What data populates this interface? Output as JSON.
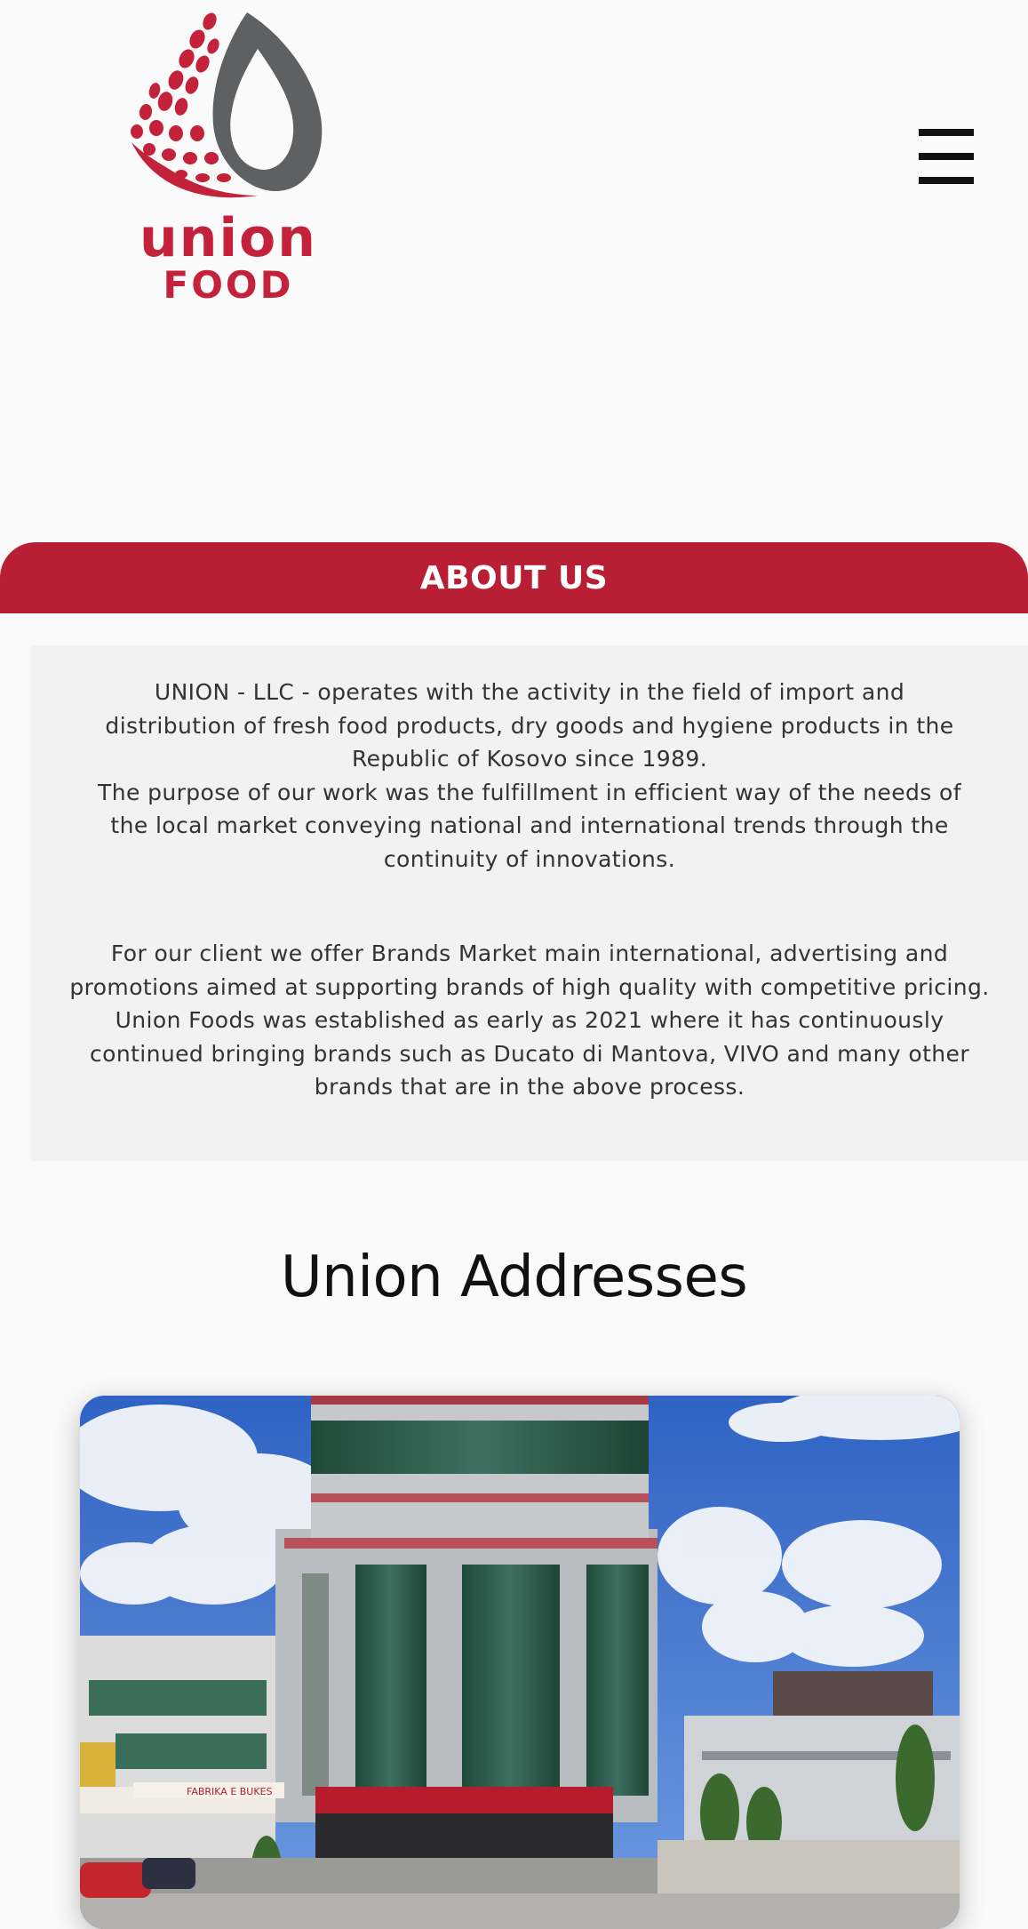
{
  "header": {
    "logo": {
      "line1": "union",
      "line2": "FOOD"
    },
    "menu_icon": "hamburger-menu-icon"
  },
  "about": {
    "title": "ABOUT US",
    "paragraph1": "UNION - LLC - operates with the activity in the field of import and distribution of fresh food products, dry goods and hygiene products in the Republic of Kosovo since 1989.\nThe purpose of our work was the fulfillment in efficient way of the needs of the local market conveying national and international trends through the continuity of innovations.",
    "paragraph2": "For our client we offer Brands Market main international, advertising and promotions aimed at supporting brands of high quality with competitive pricing. Union Foods was established as early as 2021 where it has continuously continued bringing brands such as Ducato di Mantova, VIVO and many other brands that are in the above process."
  },
  "addresses": {
    "title": "Union Addresses",
    "photo_sign": "FABRIKA E BUKES"
  },
  "colors": {
    "brand_red": "#b91f34",
    "logo_gray": "#5f6062",
    "about_bg": "#f2f2f2"
  }
}
